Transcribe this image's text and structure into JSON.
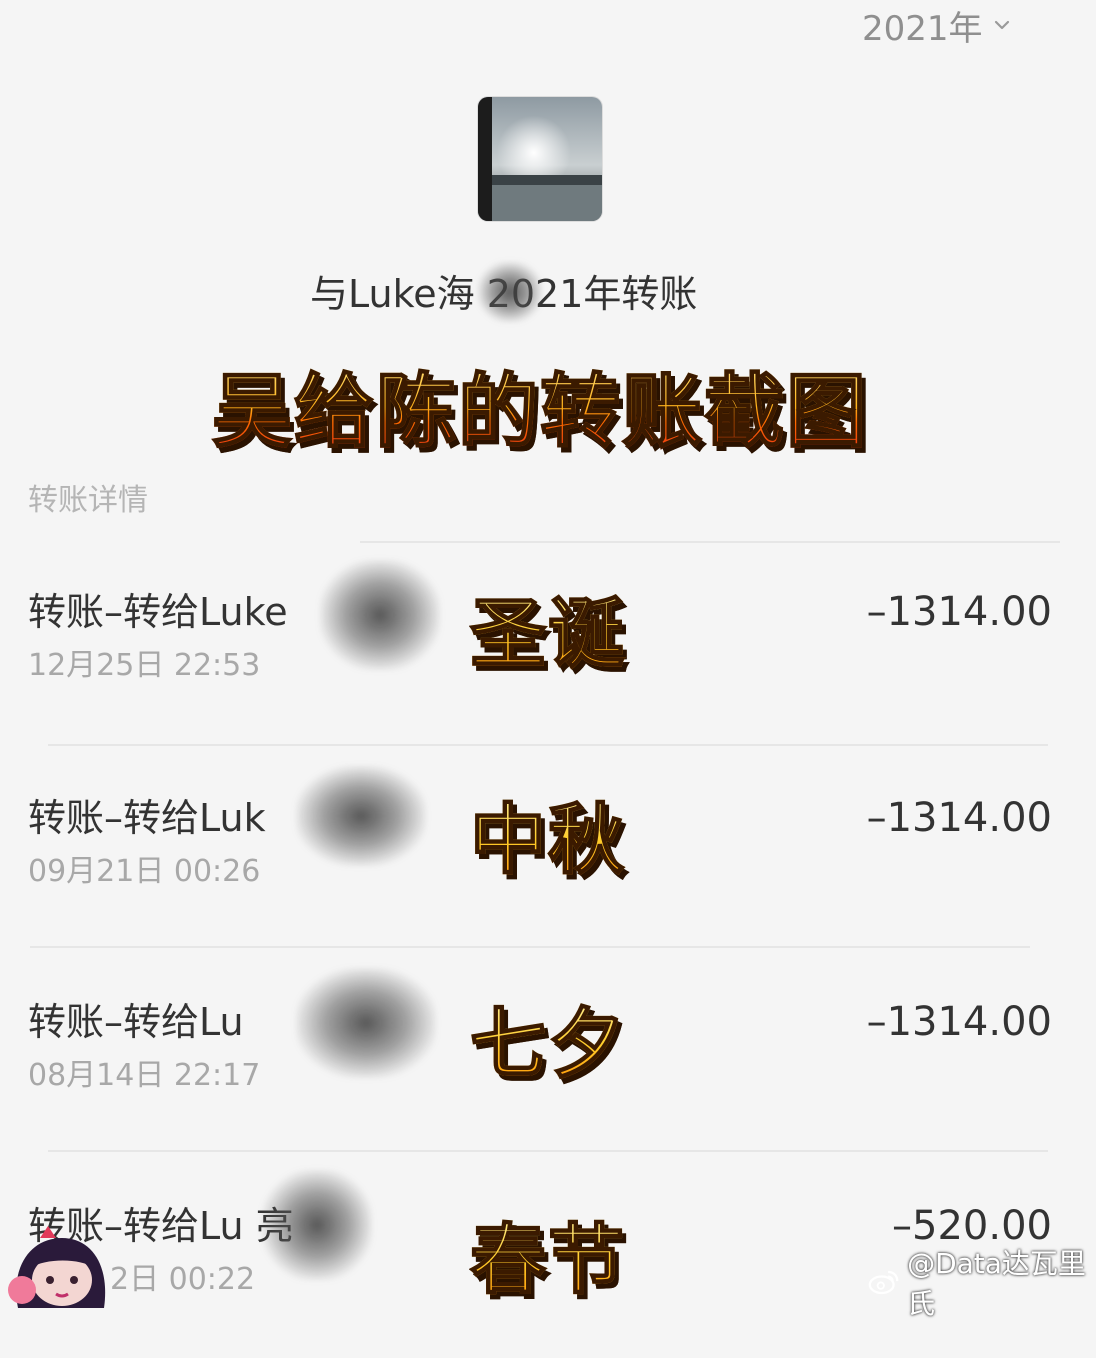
{
  "year_selector": {
    "label": "2021年"
  },
  "header": {
    "title": "与Luke海 2021年转账"
  },
  "overlay": {
    "title": "吴给陈的转账截图"
  },
  "section": {
    "label": "转账详情"
  },
  "transactions": [
    {
      "title": "转账–转给Luke",
      "date": "12月25日 22:53",
      "amount": "–1314.00",
      "sticker": "圣诞"
    },
    {
      "title": "转账–转给Luk",
      "date": "09月21日 00:26",
      "amount": "–1314.00",
      "sticker": "中秋"
    },
    {
      "title": "转账–转给Lu",
      "date": "08月14日 22:17",
      "amount": "–1314.00",
      "sticker": "七夕"
    },
    {
      "title": "转账–转给Lu 亮",
      "date": "2日 00:22",
      "amount": "–520.00",
      "sticker": "春节"
    }
  ],
  "watermark": {
    "text": "@Data达瓦里氏"
  },
  "icons": {
    "year_chevron": "chevron-down-icon",
    "watermark_logo": "weibo-logo-icon"
  }
}
